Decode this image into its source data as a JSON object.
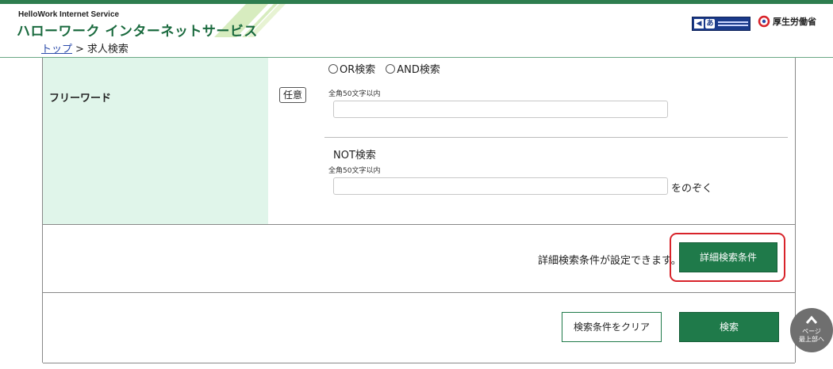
{
  "header": {
    "logo_en": "HelloWork Internet Service",
    "logo_jp": "ハローワーク インターネットサービス",
    "accessibility_icon": "accessibility-tool-icon",
    "ministry_label": "厚生労働省"
  },
  "breadcrumb": {
    "top_link": "トップ",
    "separator": ">",
    "current": "求人検索"
  },
  "free_word": {
    "label": "フリーワード",
    "optional_badge": "任意",
    "search_modes": [
      "OR検索",
      "AND検索"
    ],
    "main_hint": "全角50文字以内",
    "main_value": "",
    "not_title": "NOT検索",
    "not_hint": "全角50文字以内",
    "not_value": "",
    "exclude_suffix": "をのぞく"
  },
  "advanced": {
    "description": "詳細検索条件が設定できます。",
    "button_label": "詳細検索条件"
  },
  "actions": {
    "clear_label": "検索条件をクリア",
    "search_label": "検索"
  },
  "page_top": {
    "line1": "ページ",
    "line2": "最上部へ"
  },
  "colors": {
    "brand_green": "#1f7a4a",
    "label_bg": "#e0f5ea",
    "highlight": "#d8232a"
  }
}
